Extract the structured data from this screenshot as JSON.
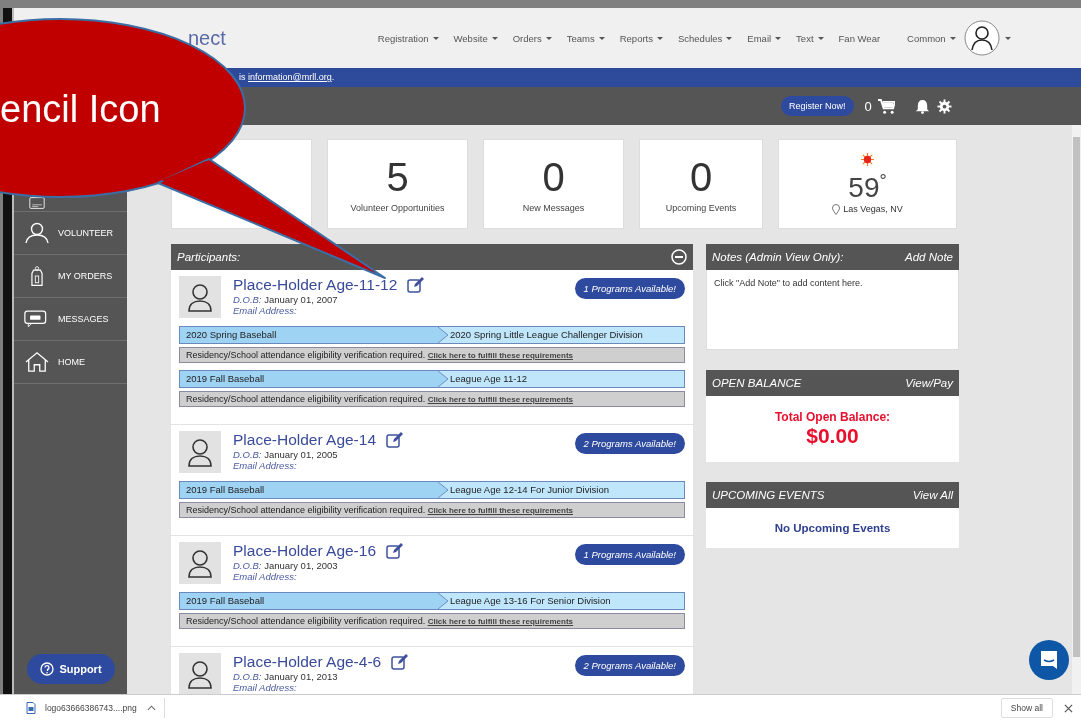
{
  "header": {
    "logo_text": "nect",
    "nav": [
      {
        "label": "Registration",
        "dropdown": true
      },
      {
        "label": "Website",
        "dropdown": true
      },
      {
        "label": "Orders",
        "dropdown": true
      },
      {
        "label": "Teams",
        "dropdown": true
      },
      {
        "label": "Reports",
        "dropdown": true
      },
      {
        "label": "Schedules",
        "dropdown": true
      },
      {
        "label": "Email",
        "dropdown": true
      },
      {
        "label": "Text",
        "dropdown": true
      },
      {
        "label": "Fan Wear",
        "dropdown": false
      },
      {
        "label": "Common",
        "dropdown": true
      }
    ]
  },
  "notice": {
    "prefix": "is",
    "email": "information@mrll.org",
    "suffix": "."
  },
  "toolbar": {
    "register_button": "Register Now!",
    "cart_count": "0"
  },
  "stats": [
    {
      "kind": "count"
    },
    {
      "kind": "count",
      "value": "5",
      "label": "Volunteer Opportunities"
    },
    {
      "kind": "count",
      "value": "0",
      "label": "New Messages"
    },
    {
      "kind": "count",
      "value": "0",
      "label": "Upcoming Events"
    },
    {
      "kind": "weather",
      "value": "59",
      "unit": "°",
      "location": "Las Vegas, NV"
    }
  ],
  "sidebar": {
    "items": [
      {
        "kind": "card"
      },
      {
        "kind": "volunteer",
        "label": "VOLUNTEER"
      },
      {
        "kind": "orders",
        "label": "MY ORDERS"
      },
      {
        "kind": "messages",
        "label": "MESSAGES"
      },
      {
        "kind": "home",
        "label": "HOME"
      }
    ],
    "support_button": "Support"
  },
  "participants": {
    "title": "Participants:",
    "items": [
      {
        "name": "Place-Holder Age-11-12",
        "dob_label": "D.O.B:",
        "dob": "January 01, 2007",
        "email_label": "Email Address:",
        "badge": "1 Programs Available!",
        "programs": [
          {
            "season": "2020 Spring Baseball",
            "division": "2020 Spring Little League Challenger Division",
            "notice": "Residency/School attendance eligibility verification required.",
            "link": "Click here to fulfill these requirements"
          },
          {
            "season": "2019 Fall Baseball",
            "division": "League Age 11-12",
            "notice": "Residency/School attendance eligibility verification required.",
            "link": "Click here to fulfill these requirements"
          }
        ]
      },
      {
        "name": "Place-Holder Age-14",
        "dob_label": "D.O.B:",
        "dob": "January 01, 2005",
        "email_label": "Email Address:",
        "badge": "2 Programs Available!",
        "programs": [
          {
            "season": "2019 Fall Baseball",
            "division": "League Age 12-14 For Junior Division",
            "notice": "Residency/School attendance eligibility verification required.",
            "link": "Click here to fulfill these requirements"
          }
        ]
      },
      {
        "name": "Place-Holder Age-16",
        "dob_label": "D.O.B:",
        "dob": "January 01, 2003",
        "email_label": "Email Address:",
        "badge": "1 Programs Available!",
        "programs": [
          {
            "season": "2019 Fall Baseball",
            "division": "League Age 13-16 For Senior Division",
            "notice": "Residency/School attendance eligibility verification required.",
            "link": "Click here to fulfill these requirements"
          }
        ]
      },
      {
        "name": "Place-Holder Age-4-6",
        "dob_label": "D.O.B:",
        "dob": "January 01, 2013",
        "email_label": "Email Address:",
        "badge": "2 Programs Available!"
      }
    ]
  },
  "notes": {
    "title": "Notes (Admin View Only):",
    "action": "Add Note",
    "body": "Click \"Add Note\" to add content here."
  },
  "balance": {
    "title": "OPEN BALANCE",
    "action": "View/Pay",
    "label": "Total Open Balance:",
    "amount": "$0.00"
  },
  "events": {
    "title": "UPCOMING EVENTS",
    "action": "View All",
    "empty": "No Upcoming Events"
  },
  "callout": {
    "text": "encil Icon"
  },
  "downloads": {
    "file": "logo63666386743....png",
    "show_all": "Show all"
  }
}
